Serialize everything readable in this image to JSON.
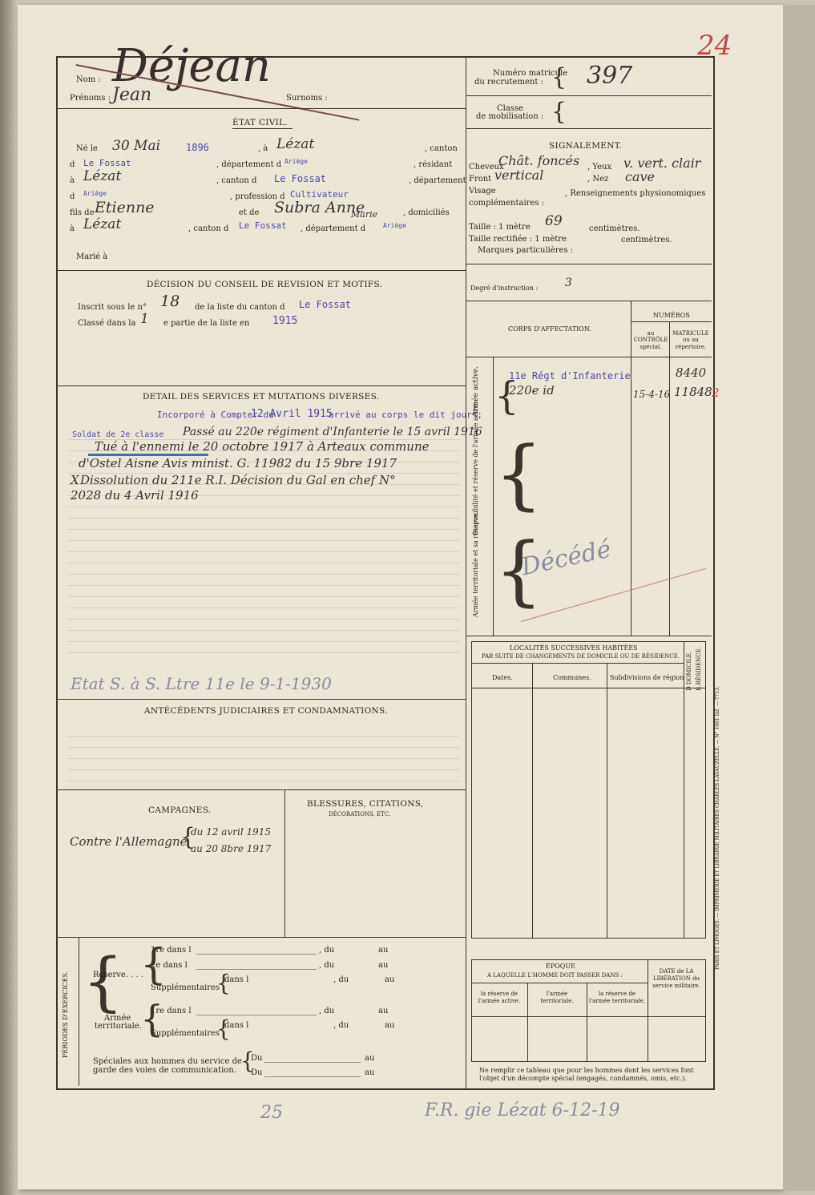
{
  "corner_number": "24",
  "header": {
    "nom_label": "Nom :",
    "nom_value": "Déjean",
    "prenoms_label": "Prénoms :",
    "prenoms_value": "Jean",
    "surnoms_label": "Surnoms :",
    "matricule_label_1": "Numéro matricule",
    "matricule_label_2": "du recrutement :",
    "matricule_value": "397",
    "classe_label_1": "Classe",
    "classe_label_2": "de mobilisation :"
  },
  "etat_civil": {
    "title": "ÉTAT CIVIL.",
    "ne_le_label": "Né le",
    "birth_date": "30 Mai",
    "birth_year": "1896",
    "a_label": ", à",
    "birth_place": "Lézat",
    "canton_label": ", canton",
    "d_label": "d",
    "canton_value": "Le Fossat",
    "departement_label": ", département d",
    "departement_value": "Ariège",
    "resident_label": ", résidant",
    "a2_label": "à",
    "residence": "Lézat",
    "canton_d_label": ", canton d",
    "res_canton": "Le Fossat",
    "departement2_label": ", département",
    "d2_label": "d",
    "res_departement": "Ariège",
    "profession_label": ", profession d",
    "profession": "Cultivateur",
    "fils_label": "fils de",
    "father": "Etienne",
    "et_de_label": "et de",
    "mother": "Subra Anne",
    "mother_extra": "Marie",
    "domicilies_label": ", domiciliés",
    "a3_label": "à",
    "parents_place": "Lézat",
    "canton3_label": ", canton d",
    "parents_canton": "Le Fossat",
    "departement3_label": ", département d",
    "parents_departement": "Ariège",
    "marie_label": "Marié à"
  },
  "signalement": {
    "title": "SIGNALEMENT.",
    "cheveux_label": "Cheveux",
    "cheveux_value": "Chât. foncés",
    "yeux_label": ", Yeux",
    "yeux_value": "v. vert. clair",
    "front_label": "Front",
    "front_value": "vertical",
    "nez_label": ", Nez",
    "nez_value": "cave",
    "visage_label": "Visage",
    "renseignements_label": ", Renseignements physionomiques",
    "complementaires_label": "complémentaires :",
    "taille_label": "Taille : 1 mètre",
    "taille_value": "69",
    "centimetres_label": "centimètres.",
    "taille_rect_label": "Taille rectifiée : 1 mètre",
    "centimetres2_label": "centimètres.",
    "marques_label": "Marques particulières :",
    "degre_label": "Degré d'instruction :",
    "degre_value": "3"
  },
  "decision": {
    "title": "DÉCISION DU CONSEIL DE REVISION ET MOTIFS.",
    "inscrit_label": "Inscrit sous le n°",
    "inscrit_value": "18",
    "liste_canton_label": "de la liste du canton d",
    "liste_canton_value": "Le Fossat",
    "classe_label": "Classé dans la",
    "classe_value": "1",
    "partie_label": "e partie de la liste en",
    "partie_value": "1915"
  },
  "affectation": {
    "numeros_label": "NUMÉROS",
    "corps_label": "CORPS D'AFFECTATION.",
    "au_controle_label": "au CONTRÔLE spécial.",
    "matricule_rep_label": "MATRICULE ou au répertoire.",
    "armee_active_label": "Armée active.",
    "disponibilite_label": "Disponibilité et réserve de l'armée active.",
    "territoriale_label": "Armée territoriale et sa réserve.",
    "corps_1": "11e Régt d'Infanterie",
    "corps_1_num": "8440",
    "corps_2": "220e  id",
    "corps_2_date": "15-4-16",
    "corps_2_num": "11848",
    "corps_2_mark": "2",
    "decede": "Décédé"
  },
  "services": {
    "title": "DETAIL DES SERVICES ET MUTATIONS DIVERSES.",
    "stamp_1": "Incorporé à Compter du",
    "stamp_1_date": "12 Avril 1915",
    "stamp_1_end": "arrivé au corps le  dit jour ;",
    "stamp_2": "Soldat de 2e classe",
    "line_1": "Passé au 220e régiment d'Infanterie le 15 avril 1916",
    "line_2": "Tué à l'ennemi le 20 octobre 1917 à Arteaux commune",
    "line_3": "d'Ostel Aisne Avis minist. G. 11982 du 15 9bre 1917",
    "line_4": "Dissolution du 211e R.I. Décision du Gal en chef N°",
    "line_5": "2028 du 4 Avril 1916",
    "line_4_mark": "X",
    "pencil_note": "Etat S. à S. Ltre 11e le 9-1-1930"
  },
  "localites": {
    "title": "LOCALITÉS SUCCESSIVES HABITÉES",
    "subtitle": "PAR SUITE DE CHANGEMENTS DE DOMICILE OU DE RÉSIDENCE.",
    "col_dates": "Dates.",
    "col_communes": "Communes.",
    "col_subdivisions": "Subdivisions de région",
    "col_domicile": "D DOMICILE.",
    "col_residence": "R RÉSIDENCE."
  },
  "antecedents": {
    "title": "ANTÉCÉDENTS JUDICIAIRES ET CONDAMNATIONS."
  },
  "campagnes": {
    "title": "CAMPAGNES.",
    "entry": "Contre l'Allemagne",
    "from": "du 12 avril 1915",
    "to": "au 20 8bre 1917"
  },
  "blessures": {
    "title": "BLESSURES, CITATIONS,",
    "subtitle": "DÉCORATIONS, ETC."
  },
  "periodes": {
    "side_label": "PÉRIODES D'EXERCICES.",
    "reserve_label": "Réserve. . . .",
    "r1": "1re dans l",
    "r2": "2e dans l",
    "supp_label": "Supplémentaires",
    "dans_l": "dans l",
    "du": ", du",
    "au": "au",
    "armee_label": "Armée",
    "territoriale_label": "territoriale.",
    "t1": "1re dans l",
    "speciales_1": "Spéciales aux hommes du service de",
    "speciales_2": "garde des voies de communication.",
    "du2": "Du",
    "au2": "au"
  },
  "epoque": {
    "title": "ÉPOQUE",
    "subtitle": "A LAQUELLE L'HOMME DOIT PASSER DANS :",
    "c1": "la réserve de l'armée active.",
    "c2": "l'armée territoriale.",
    "c3": "la réserve de l'armée territoriale.",
    "date_label": "DATE de LA LIBÉRATION du service militaire.",
    "note_1": "Ne remplir ce tableau que pour les hommes dont les services font",
    "note_2": "l'objet d'un décompte spécial (engagés, condamnés, omis, etc.)."
  },
  "printer": "PARIS ET LIMOGES. — IMPRIMERIE ET LIBRAIRIE MILITAIRES CHARLES-LAVAUZELLE. — N° 1001 Inf. — 7713.",
  "footer": {
    "mark_left": "25",
    "stamp": "F.R. gie Lézat 6-12-19"
  }
}
